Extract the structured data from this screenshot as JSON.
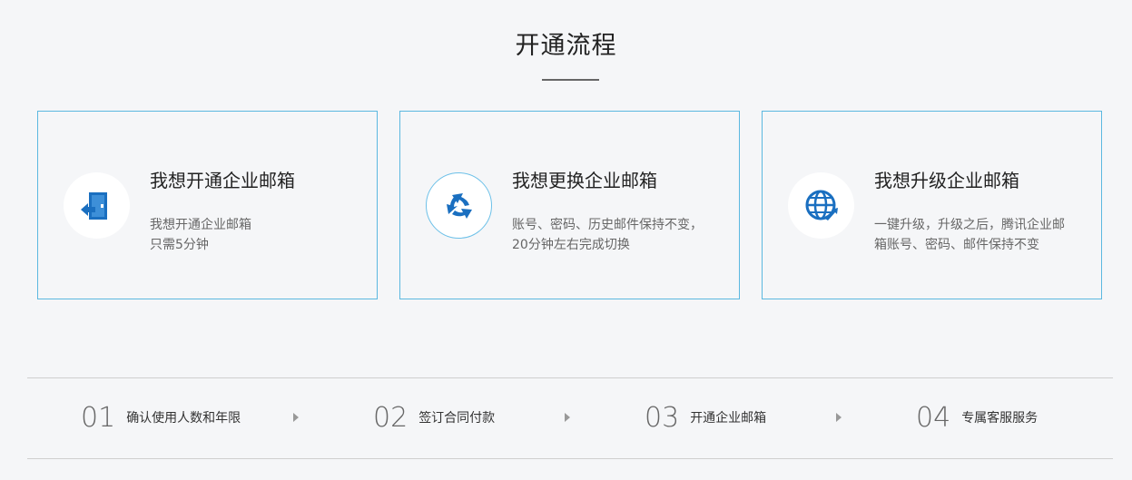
{
  "title": "开通流程",
  "cards": [
    {
      "icon": "door-enter-icon",
      "title": "我想开通企业邮箱",
      "desc": [
        "我想开通企业邮箱",
        "只需5分钟"
      ]
    },
    {
      "icon": "refresh-cycle-icon",
      "title": "我想更换企业邮箱",
      "desc": [
        "账号、密码、历史邮件保持不变，",
        "20分钟左右完成切换"
      ]
    },
    {
      "icon": "globe-upgrade-icon",
      "title": "我想升级企业邮箱",
      "desc": [
        "一键升级，升级之后，腾讯企业邮",
        "箱账号、密码、邮件保持不变"
      ]
    }
  ],
  "steps": [
    {
      "num": "01",
      "label": "确认使用人数和年限"
    },
    {
      "num": "02",
      "label": "签订合同付款"
    },
    {
      "num": "03",
      "label": "开通企业邮箱"
    },
    {
      "num": "04",
      "label": "专属客服服务"
    }
  ],
  "colors": {
    "accent": "#1a6fc0",
    "card_border": "#5bb8e0"
  }
}
